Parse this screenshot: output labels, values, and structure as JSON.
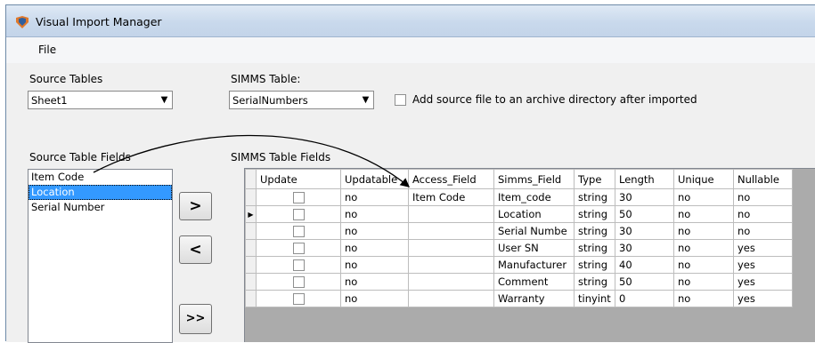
{
  "window": {
    "title": "Visual Import Manager"
  },
  "menu": {
    "file": "File"
  },
  "source_tables": {
    "label": "Source Tables",
    "selected": "Sheet1"
  },
  "simms_table": {
    "label": "SIMMS Table:",
    "selected": "SerialNumbers"
  },
  "archive": {
    "label": "Add source file to an archive directory after imported",
    "checked": false
  },
  "source_fields": {
    "label": "Source Table Fields",
    "items": [
      "Item Code",
      "Location",
      "Serial Number"
    ],
    "selected_index": 1
  },
  "buttons": {
    "add": ">",
    "remove": "<",
    "add_all": ">>"
  },
  "simms_fields": {
    "label": "SIMMS Table Fields",
    "columns": [
      "Update",
      "Updatable",
      "Access_Field",
      "Simms_Field",
      "Type",
      "Length",
      "Unique",
      "Nullable"
    ],
    "current_row": 1,
    "rows": [
      {
        "updatable": "no",
        "access_field": "Item Code",
        "simms_field": "Item_code",
        "type": "string",
        "length": "30",
        "unique": "no",
        "nullable": "no"
      },
      {
        "updatable": "no",
        "access_field": "",
        "simms_field": "Location",
        "type": "string",
        "length": "50",
        "unique": "no",
        "nullable": "no"
      },
      {
        "updatable": "no",
        "access_field": "",
        "simms_field": "Serial Numbe",
        "type": "string",
        "length": "30",
        "unique": "no",
        "nullable": "no"
      },
      {
        "updatable": "no",
        "access_field": "",
        "simms_field": "User SN",
        "type": "string",
        "length": "30",
        "unique": "no",
        "nullable": "yes"
      },
      {
        "updatable": "no",
        "access_field": "",
        "simms_field": "Manufacturer",
        "type": "string",
        "length": "40",
        "unique": "no",
        "nullable": "yes"
      },
      {
        "updatable": "no",
        "access_field": "",
        "simms_field": "Comment",
        "type": "string",
        "length": "50",
        "unique": "no",
        "nullable": "yes"
      },
      {
        "updatable": "no",
        "access_field": "",
        "simms_field": "Warranty",
        "type": "tinyint",
        "length": "0",
        "unique": "no",
        "nullable": "yes"
      }
    ]
  },
  "icons": {
    "app": "app-logo-icon",
    "dropdown": "chevron-down-icon",
    "row_pointer": "row-pointer-icon"
  },
  "colors": {
    "selection": "#3399ff",
    "titlebar": "#c9d9ec"
  }
}
